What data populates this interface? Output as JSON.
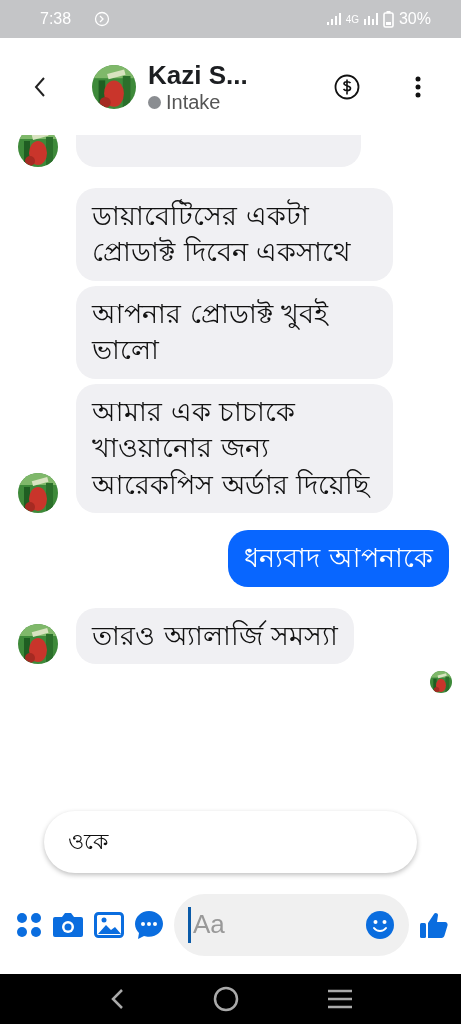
{
  "status_bar": {
    "time": "7:38",
    "network": "4G",
    "battery": "30%"
  },
  "header": {
    "name": "Kazi S...",
    "status": "Intake"
  },
  "messages": [
    {
      "kind": "partial",
      "avatar": true
    },
    {
      "kind": "text",
      "from_me": false,
      "avatar": false,
      "text": "ডায়াবেটিসের একটা প্রোডাক্ট দিবেন একসাথে"
    },
    {
      "kind": "text",
      "from_me": false,
      "avatar": false,
      "text": "আপনার প্রোডাক্ট খুবই ভালো"
    },
    {
      "kind": "text",
      "from_me": false,
      "avatar": true,
      "text": "আমার এক চাচাকে খাওয়ানোর জন্য আরেকপিস অর্ডার দিয়েছি"
    },
    {
      "kind": "text",
      "from_me": true,
      "avatar": false,
      "text": "ধন্যবাদ আপনাকে"
    },
    {
      "kind": "text",
      "from_me": false,
      "avatar": true,
      "text": "তারও অ্যালার্জি সমস্যা"
    }
  ],
  "seen": true,
  "quick_reply": "ওকে",
  "composer": {
    "placeholder": "Aa"
  }
}
